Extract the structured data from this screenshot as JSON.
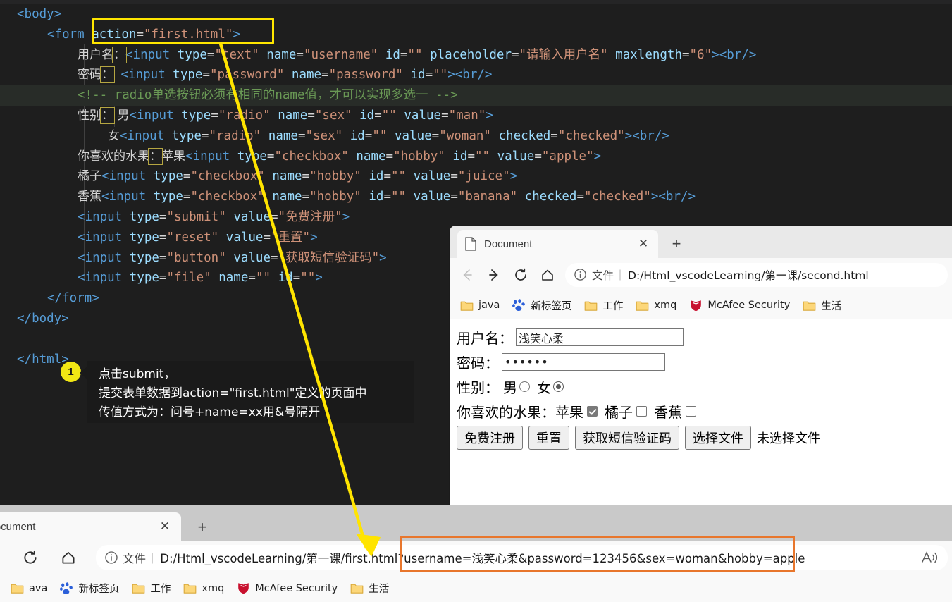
{
  "editor": {
    "lines": [
      {
        "indent": 0,
        "hl": false,
        "parts": [
          {
            "t": "tag",
            "v": "<body>"
          }
        ]
      },
      {
        "indent": 1,
        "hl": false,
        "parts": [
          {
            "t": "tag",
            "v": "<form "
          },
          {
            "t": "attr",
            "v": "action"
          },
          {
            "t": "eq",
            "v": "="
          },
          {
            "t": "str",
            "v": "\"first.html\""
          },
          {
            "t": "tag",
            "v": ">"
          }
        ]
      },
      {
        "indent": 2,
        "hl": false,
        "parts": [
          {
            "t": "txt",
            "v": "用户名"
          },
          {
            "t": "brk",
            "v": "："
          },
          {
            "t": "tag",
            "v": "<input "
          },
          {
            "t": "attr",
            "v": "type"
          },
          {
            "t": "eq",
            "v": "="
          },
          {
            "t": "str",
            "v": "\"text\""
          },
          {
            "t": "eq",
            "v": " "
          },
          {
            "t": "attr",
            "v": "name"
          },
          {
            "t": "eq",
            "v": "="
          },
          {
            "t": "str",
            "v": "\"username\""
          },
          {
            "t": "eq",
            "v": " "
          },
          {
            "t": "attr",
            "v": "id"
          },
          {
            "t": "eq",
            "v": "="
          },
          {
            "t": "str",
            "v": "\"\""
          },
          {
            "t": "eq",
            "v": " "
          },
          {
            "t": "attr",
            "v": "placeholder"
          },
          {
            "t": "eq",
            "v": "="
          },
          {
            "t": "str",
            "v": "\"请输入用户名\""
          },
          {
            "t": "eq",
            "v": " "
          },
          {
            "t": "attr",
            "v": "maxlength"
          },
          {
            "t": "eq",
            "v": "="
          },
          {
            "t": "str",
            "v": "\"6\""
          },
          {
            "t": "tag",
            "v": "><br/>"
          }
        ]
      },
      {
        "indent": 2,
        "hl": false,
        "parts": [
          {
            "t": "txt",
            "v": "密码"
          },
          {
            "t": "brk",
            "v": "："
          },
          {
            "t": "tag",
            "v": " <input "
          },
          {
            "t": "attr",
            "v": "type"
          },
          {
            "t": "eq",
            "v": "="
          },
          {
            "t": "str",
            "v": "\"password\""
          },
          {
            "t": "eq",
            "v": " "
          },
          {
            "t": "attr",
            "v": "name"
          },
          {
            "t": "eq",
            "v": "="
          },
          {
            "t": "str",
            "v": "\"password\""
          },
          {
            "t": "eq",
            "v": " "
          },
          {
            "t": "attr",
            "v": "id"
          },
          {
            "t": "eq",
            "v": "="
          },
          {
            "t": "str",
            "v": "\"\""
          },
          {
            "t": "tag",
            "v": "><br/>"
          }
        ]
      },
      {
        "indent": 2,
        "hl": true,
        "parts": [
          {
            "t": "cmt",
            "v": "<!-- radio单选按钮必须有相同的name值，才可以实现多选一 -->"
          }
        ]
      },
      {
        "indent": 2,
        "hl": false,
        "parts": [
          {
            "t": "txt",
            "v": "性别"
          },
          {
            "t": "brk",
            "v": "："
          },
          {
            "t": "txt",
            "v": " 男"
          },
          {
            "t": "tag",
            "v": "<input "
          },
          {
            "t": "attr",
            "v": "type"
          },
          {
            "t": "eq",
            "v": "="
          },
          {
            "t": "str",
            "v": "\"radio\""
          },
          {
            "t": "eq",
            "v": " "
          },
          {
            "t": "attr",
            "v": "name"
          },
          {
            "t": "eq",
            "v": "="
          },
          {
            "t": "str",
            "v": "\"sex\""
          },
          {
            "t": "eq",
            "v": " "
          },
          {
            "t": "attr",
            "v": "id"
          },
          {
            "t": "eq",
            "v": "="
          },
          {
            "t": "str",
            "v": "\"\""
          },
          {
            "t": "eq",
            "v": " "
          },
          {
            "t": "attr",
            "v": "value"
          },
          {
            "t": "eq",
            "v": "="
          },
          {
            "t": "str",
            "v": "\"man\""
          },
          {
            "t": "tag",
            "v": ">"
          }
        ]
      },
      {
        "indent": 3,
        "hl": false,
        "parts": [
          {
            "t": "txt",
            "v": "女"
          },
          {
            "t": "tag",
            "v": "<input "
          },
          {
            "t": "attr",
            "v": "type"
          },
          {
            "t": "eq",
            "v": "="
          },
          {
            "t": "str",
            "v": "\"radio\""
          },
          {
            "t": "eq",
            "v": " "
          },
          {
            "t": "attr",
            "v": "name"
          },
          {
            "t": "eq",
            "v": "="
          },
          {
            "t": "str",
            "v": "\"sex\""
          },
          {
            "t": "eq",
            "v": " "
          },
          {
            "t": "attr",
            "v": "id"
          },
          {
            "t": "eq",
            "v": "="
          },
          {
            "t": "str",
            "v": "\"\""
          },
          {
            "t": "eq",
            "v": " "
          },
          {
            "t": "attr",
            "v": "value"
          },
          {
            "t": "eq",
            "v": "="
          },
          {
            "t": "str",
            "v": "\"woman\""
          },
          {
            "t": "eq",
            "v": " "
          },
          {
            "t": "attr",
            "v": "checked"
          },
          {
            "t": "eq",
            "v": "="
          },
          {
            "t": "str",
            "v": "\"checked\""
          },
          {
            "t": "tag",
            "v": "><br/>"
          }
        ]
      },
      {
        "indent": 2,
        "hl": false,
        "parts": [
          {
            "t": "txt",
            "v": "你喜欢的水果"
          },
          {
            "t": "brk",
            "v": "："
          },
          {
            "t": "txt",
            "v": "苹果"
          },
          {
            "t": "tag",
            "v": "<input "
          },
          {
            "t": "attr",
            "v": "type"
          },
          {
            "t": "eq",
            "v": "="
          },
          {
            "t": "str",
            "v": "\"checkbox\""
          },
          {
            "t": "eq",
            "v": " "
          },
          {
            "t": "attr",
            "v": "name"
          },
          {
            "t": "eq",
            "v": "="
          },
          {
            "t": "str",
            "v": "\"hobby\""
          },
          {
            "t": "eq",
            "v": " "
          },
          {
            "t": "attr",
            "v": "id"
          },
          {
            "t": "eq",
            "v": "="
          },
          {
            "t": "str",
            "v": "\"\""
          },
          {
            "t": "eq",
            "v": " "
          },
          {
            "t": "attr",
            "v": "value"
          },
          {
            "t": "eq",
            "v": "="
          },
          {
            "t": "str",
            "v": "\"apple\""
          },
          {
            "t": "tag",
            "v": ">"
          }
        ]
      },
      {
        "indent": 2,
        "hl": false,
        "parts": [
          {
            "t": "txt",
            "v": "橘子"
          },
          {
            "t": "tag",
            "v": "<input "
          },
          {
            "t": "attr",
            "v": "type"
          },
          {
            "t": "eq",
            "v": "="
          },
          {
            "t": "str",
            "v": "\"checkbox\""
          },
          {
            "t": "eq",
            "v": " "
          },
          {
            "t": "attr",
            "v": "name"
          },
          {
            "t": "eq",
            "v": "="
          },
          {
            "t": "str",
            "v": "\"hobby\""
          },
          {
            "t": "eq",
            "v": " "
          },
          {
            "t": "attr",
            "v": "id"
          },
          {
            "t": "eq",
            "v": "="
          },
          {
            "t": "str",
            "v": "\"\""
          },
          {
            "t": "eq",
            "v": " "
          },
          {
            "t": "attr",
            "v": "value"
          },
          {
            "t": "eq",
            "v": "="
          },
          {
            "t": "str",
            "v": "\"juice\""
          },
          {
            "t": "tag",
            "v": ">"
          }
        ]
      },
      {
        "indent": 2,
        "hl": false,
        "parts": [
          {
            "t": "txt",
            "v": "香蕉"
          },
          {
            "t": "tag",
            "v": "<input "
          },
          {
            "t": "attr",
            "v": "type"
          },
          {
            "t": "eq",
            "v": "="
          },
          {
            "t": "str",
            "v": "\"checkbox\""
          },
          {
            "t": "eq",
            "v": " "
          },
          {
            "t": "attr",
            "v": "name"
          },
          {
            "t": "eq",
            "v": "="
          },
          {
            "t": "str",
            "v": "\"hobby\""
          },
          {
            "t": "eq",
            "v": " "
          },
          {
            "t": "attr",
            "v": "id"
          },
          {
            "t": "eq",
            "v": "="
          },
          {
            "t": "str",
            "v": "\"\""
          },
          {
            "t": "eq",
            "v": " "
          },
          {
            "t": "attr",
            "v": "value"
          },
          {
            "t": "eq",
            "v": "="
          },
          {
            "t": "str",
            "v": "\"banana\""
          },
          {
            "t": "eq",
            "v": " "
          },
          {
            "t": "attr",
            "v": "checked"
          },
          {
            "t": "eq",
            "v": "="
          },
          {
            "t": "str",
            "v": "\"checked\""
          },
          {
            "t": "tag",
            "v": "><br/>"
          }
        ]
      },
      {
        "indent": 2,
        "hl": false,
        "parts": [
          {
            "t": "tag",
            "v": "<input "
          },
          {
            "t": "attr",
            "v": "type"
          },
          {
            "t": "eq",
            "v": "="
          },
          {
            "t": "str",
            "v": "\"submit\""
          },
          {
            "t": "eq",
            "v": " "
          },
          {
            "t": "attr",
            "v": "value"
          },
          {
            "t": "eq",
            "v": "="
          },
          {
            "t": "str",
            "v": "\"免费注册\""
          },
          {
            "t": "tag",
            "v": ">"
          }
        ]
      },
      {
        "indent": 2,
        "hl": false,
        "parts": [
          {
            "t": "tag",
            "v": "<input "
          },
          {
            "t": "attr",
            "v": "type"
          },
          {
            "t": "eq",
            "v": "="
          },
          {
            "t": "str",
            "v": "\"reset\""
          },
          {
            "t": "eq",
            "v": " "
          },
          {
            "t": "attr",
            "v": "value"
          },
          {
            "t": "eq",
            "v": "="
          },
          {
            "t": "str",
            "v": "\"重置\""
          },
          {
            "t": "tag",
            "v": ">"
          }
        ]
      },
      {
        "indent": 2,
        "hl": false,
        "parts": [
          {
            "t": "tag",
            "v": "<input "
          },
          {
            "t": "attr",
            "v": "type"
          },
          {
            "t": "eq",
            "v": "="
          },
          {
            "t": "str",
            "v": "\"button\""
          },
          {
            "t": "eq",
            "v": " "
          },
          {
            "t": "attr",
            "v": "value"
          },
          {
            "t": "eq",
            "v": "="
          },
          {
            "t": "str",
            "v": "\"获取短信验证码\""
          },
          {
            "t": "tag",
            "v": ">"
          }
        ]
      },
      {
        "indent": 2,
        "hl": false,
        "parts": [
          {
            "t": "tag",
            "v": "<input "
          },
          {
            "t": "attr",
            "v": "type"
          },
          {
            "t": "eq",
            "v": "="
          },
          {
            "t": "str",
            "v": "\"file\""
          },
          {
            "t": "eq",
            "v": " "
          },
          {
            "t": "attr",
            "v": "name"
          },
          {
            "t": "eq",
            "v": "="
          },
          {
            "t": "str",
            "v": "\"\""
          },
          {
            "t": "eq",
            "v": " "
          },
          {
            "t": "attr",
            "v": "id"
          },
          {
            "t": "eq",
            "v": "="
          },
          {
            "t": "str",
            "v": "\"\""
          },
          {
            "t": "tag",
            "v": ">"
          }
        ]
      },
      {
        "indent": 1,
        "hl": false,
        "parts": [
          {
            "t": "tag",
            "v": "</form>"
          }
        ]
      },
      {
        "indent": 0,
        "hl": false,
        "parts": [
          {
            "t": "tag",
            "v": "</body>"
          }
        ]
      },
      {
        "indent": 0,
        "hl": false,
        "parts": []
      },
      {
        "indent": 0,
        "hl": false,
        "parts": [
          {
            "t": "tag",
            "v": "</html>"
          }
        ]
      }
    ]
  },
  "callout": {
    "badge": "1",
    "line1": "点击submit，",
    "line2": "提交表单数据到action=\"first.html\"定义的页面中",
    "line3": "传值方式为：问号+name=xx用&号隔开"
  },
  "browser_top": {
    "tab_title": "Document",
    "close_label": "✕",
    "newtab_label": "+",
    "nav": {
      "back": "←",
      "forward": "→",
      "reload": "⟳",
      "home": "⌂"
    },
    "omnibox": {
      "scheme_label": "文件",
      "separator": "|",
      "url": "D:/Html_vscodeLearning/第一课/second.html"
    },
    "bookmarks": [
      {
        "label": "java",
        "icon": "folder-icon"
      },
      {
        "label": "新标签页",
        "icon": "baidu-icon"
      },
      {
        "label": "工作",
        "icon": "folder-icon"
      },
      {
        "label": "xmq",
        "icon": "folder-icon"
      },
      {
        "label": "McAfee Security",
        "icon": "mcafee-icon"
      },
      {
        "label": "生活",
        "icon": "folder-icon"
      }
    ],
    "page": {
      "username_label": "用户名：",
      "username_value": "浅笑心柔",
      "password_label": "密码：",
      "password_value": "••••••",
      "sex_label": "性别：",
      "sex_male": "男",
      "sex_female": "女",
      "fruit_label": "你喜欢的水果：",
      "fruit_apple": "苹果",
      "fruit_orange": "橘子",
      "fruit_banana": "香蕉",
      "btn_submit": "免费注册",
      "btn_reset": "重置",
      "btn_sms": "获取短信验证码",
      "btn_file": "选择文件",
      "file_status": "未选择文件"
    }
  },
  "browser_bottom": {
    "tab_title": "Document",
    "close_label": "✕",
    "newtab_label": "+",
    "nav": {
      "reload": "⟳",
      "home": "⌂"
    },
    "omnibox": {
      "scheme_label": "文件",
      "separator": "|",
      "url_base": "D:/Html_vscodeLearning/第一课/first.html",
      "url_query": "?username=浅笑心柔&password=123456&sex=woman&hobby=apple"
    },
    "bookmarks": [
      {
        "label": "ava",
        "icon": "folder-icon"
      },
      {
        "label": "新标签页",
        "icon": "baidu-icon"
      },
      {
        "label": "工作",
        "icon": "folder-icon"
      },
      {
        "label": "xmq",
        "icon": "folder-icon"
      },
      {
        "label": "McAfee Security",
        "icon": "mcafee-icon"
      },
      {
        "label": "生活",
        "icon": "folder-icon"
      }
    ]
  },
  "colors": {
    "editor_bg": "#1e1e1e",
    "highlight_yellow": "#ffe600",
    "highlight_orange": "#e8762c",
    "arrow_yellow": "#ffe400",
    "badge_yellow": "#f2e714"
  }
}
